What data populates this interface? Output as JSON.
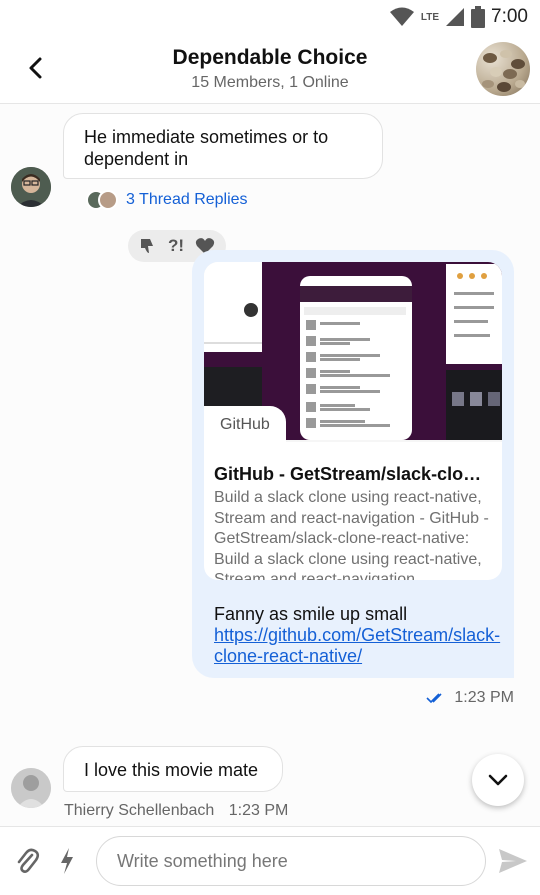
{
  "status_bar": {
    "time": "7:00",
    "network": "LTE",
    "icons": [
      "wifi-icon",
      "signal-icon",
      "battery-icon"
    ]
  },
  "header": {
    "title": "Dependable Choice",
    "subtitle": "15 Members, 1 Online",
    "back_icon": "chevron-left-icon"
  },
  "messages": [
    {
      "text": "He immediate sometimes or to dependent in",
      "thread_replies": "3 Thread Replies"
    },
    {
      "reactions": [
        "thumbs-down-icon",
        "interrobang-icon",
        "heart-icon"
      ],
      "attachment": {
        "source": "GitHub",
        "title": "GitHub - GetStream/slack-clone…",
        "description": "Build a slack clone using react-native, Stream and react-navigation - GitHub - GetStream/slack-clone-react-native: Build a slack clone using react-native, Stream and react-navigation"
      },
      "text": "Fanny as smile up small",
      "link": "https://github.com/GetStream/slack-clone-react-native/",
      "time": "1:23 PM"
    },
    {
      "text": "I love this movie mate",
      "sender": "Thierry Schellenbach",
      "time": "1:23 PM"
    }
  ],
  "composer": {
    "placeholder": "Write something here"
  },
  "colors": {
    "accent": "#1460d6",
    "own_bubble": "#e8f1fd",
    "card_image_bg": "#3b0f3a"
  }
}
